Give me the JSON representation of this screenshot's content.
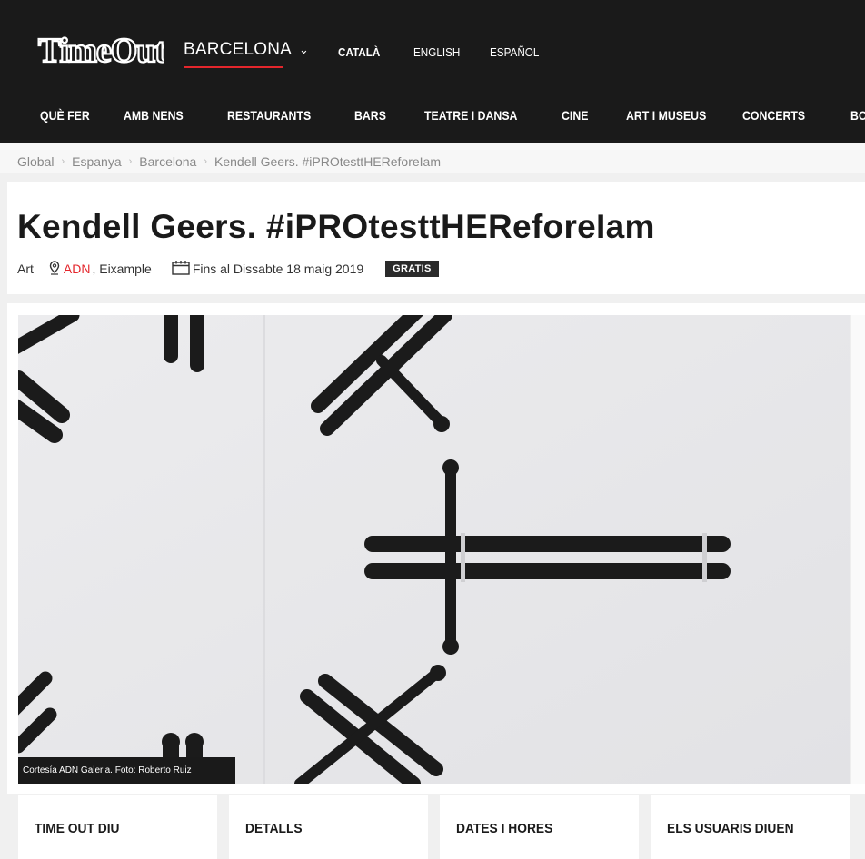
{
  "header": {
    "logo_text": "TimeOut",
    "city": "BARCELONA",
    "languages": [
      "CATALÀ",
      "ENGLISH",
      "ESPAÑOL"
    ]
  },
  "nav": [
    "QUÈ FER",
    "AMB NENS",
    "RESTAURANTS",
    "BARS",
    "TEATRE I DANSA",
    "CINE",
    "ART I MUSEUS",
    "CONCERTS",
    "BO"
  ],
  "breadcrumb": [
    "Global",
    "Espanya",
    "Barcelona",
    "Kendell Geers. #iPROtesttHEReforeIam"
  ],
  "article": {
    "title": "Kendell Geers. #iPROtesttHEReforeIam",
    "category": "Art",
    "venue": "ADN",
    "area": ", Eixample",
    "dates": "Fins al Dissabte 18 maig 2019",
    "price_badge": "GRATIS"
  },
  "image": {
    "caption": "Cortesía ADN Galeria. Foto: Roberto Ruiz"
  },
  "tabs": [
    "TIME OUT DIU",
    "DETALLS",
    "DATES I HORES",
    "ELS USUARIS DIUEN"
  ],
  "colors": {
    "accent": "#e4262c",
    "dark": "#1a1a1a"
  }
}
